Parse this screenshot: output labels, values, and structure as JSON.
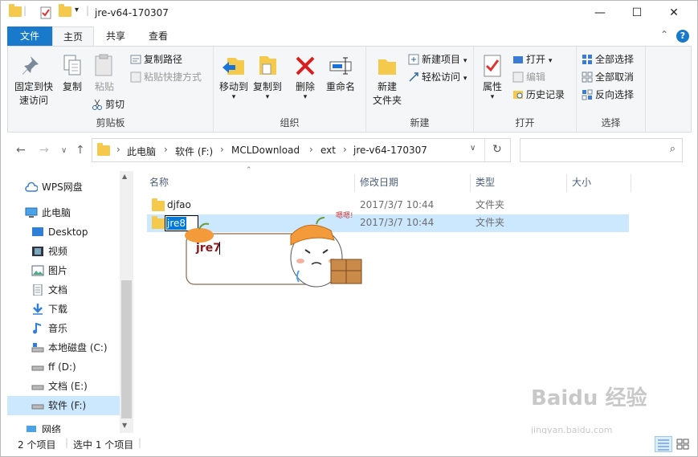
{
  "window": {
    "title": "jre-v64-170307",
    "controls": {
      "minimize": "—",
      "maximize": "☐",
      "close": "✕"
    }
  },
  "tabs": [
    {
      "label": "文件"
    },
    {
      "label": "主页"
    },
    {
      "label": "共享"
    },
    {
      "label": "查看"
    }
  ],
  "ribbon": {
    "clipboard": {
      "label": "剪贴板",
      "pin": "固定到快\n速访问",
      "copy": "复制",
      "paste": "粘贴",
      "copy_path": "复制路径",
      "paste_shortcut": "粘贴快捷方式",
      "cut": "剪切"
    },
    "organize": {
      "label": "组织",
      "move_to": "移动到",
      "copy_to": "复制到",
      "delete": "删除",
      "rename": "重命名"
    },
    "new": {
      "label": "新建",
      "new_folder": "新建\n文件夹",
      "new_item": "新建项目",
      "easy_access": "轻松访问"
    },
    "open": {
      "label": "打开",
      "properties": "属性",
      "open": "打开",
      "edit": "编辑",
      "history": "历史记录"
    },
    "select": {
      "label": "选择",
      "select_all": "全部选择",
      "select_none": "全部取消",
      "invert": "反向选择"
    }
  },
  "address": {
    "crumbs": [
      "此电脑",
      "软件 (F:)",
      "MCLDownload",
      "ext",
      "jre-v64-170307"
    ],
    "search_placeholder": ""
  },
  "nav": {
    "items": [
      {
        "label": "WPS网盘",
        "icon": "cloud-icon"
      },
      {
        "label": "此电脑",
        "icon": "computer-icon"
      },
      {
        "label": "Desktop",
        "icon": "desktop-icon"
      },
      {
        "label": "视频",
        "icon": "video-icon"
      },
      {
        "label": "图片",
        "icon": "picture-icon"
      },
      {
        "label": "文档",
        "icon": "document-icon"
      },
      {
        "label": "下载",
        "icon": "download-icon"
      },
      {
        "label": "音乐",
        "icon": "music-icon"
      },
      {
        "label": "本地磁盘 (C:)",
        "icon": "drive-icon"
      },
      {
        "label": "ff (D:)",
        "icon": "drive-icon"
      },
      {
        "label": "文档 (E:)",
        "icon": "drive-icon"
      },
      {
        "label": "软件 (F:)",
        "icon": "drive-icon"
      },
      {
        "label": "网络",
        "icon": "network-icon"
      }
    ]
  },
  "columns": {
    "name": "名称",
    "modified": "修改日期",
    "type": "类型",
    "size": "大小"
  },
  "files": [
    {
      "name": "djfao",
      "modified": "2017/3/7 10:44",
      "type": "文件夹"
    },
    {
      "name": "jre8",
      "modified": "2017/3/7 10:44",
      "type": "文件夹"
    }
  ],
  "sticker": {
    "text": "jre7",
    "exclaim": "嗯嗯!"
  },
  "status": {
    "count": "2 个项目",
    "selected": "选中 1 个项目"
  },
  "watermark": {
    "main": "Baidu 经验",
    "sub": "jingyan.baidu.com"
  },
  "colors": {
    "file_tab": "#1979ca",
    "selection": "#cce8ff",
    "folder": "#f5c94c",
    "accent": "#0078d7"
  }
}
